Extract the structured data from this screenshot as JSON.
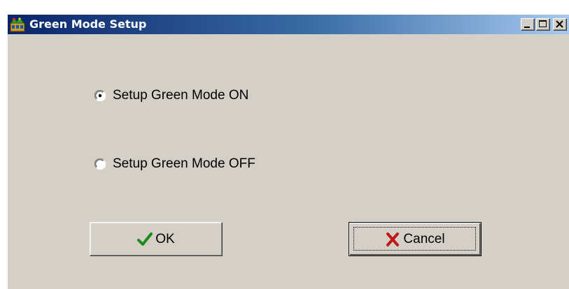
{
  "window": {
    "title": "Green Mode Setup",
    "controls": {
      "minimize_icon": "minimize-icon",
      "maximize_icon": "maximize-icon",
      "close_icon": "close-icon"
    }
  },
  "options": [
    {
      "label": "Setup Green Mode ON",
      "selected": true
    },
    {
      "label": "Setup Green Mode OFF",
      "selected": false
    }
  ],
  "buttons": {
    "ok": {
      "label": "OK",
      "icon": "checkmark-icon",
      "icon_color": "#1a8a1a"
    },
    "cancel": {
      "label": "Cancel",
      "icon": "x-mark-icon",
      "icon_color": "#c01818",
      "focused": true
    }
  },
  "colors": {
    "titlebar_start": "#0a246a",
    "titlebar_end": "#a6caf0",
    "face": "#d4d0c8"
  }
}
